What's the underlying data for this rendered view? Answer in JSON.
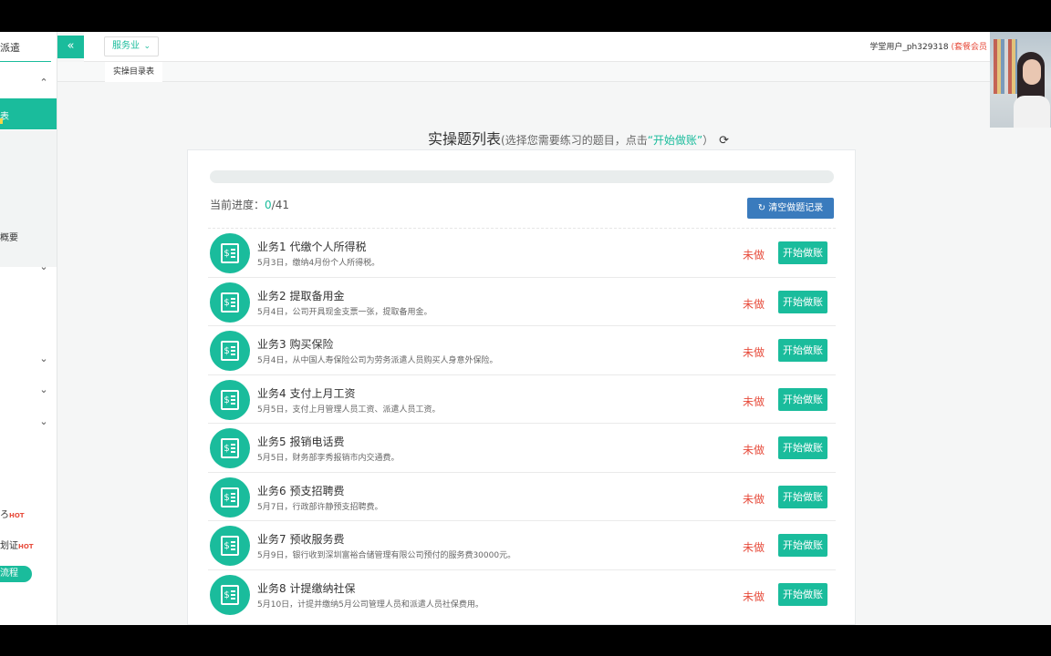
{
  "sidebar": {
    "brand": "派遣",
    "active_item": "表",
    "sub_item": "概要",
    "hot_items": [
      {
        "label": "ろ",
        "badge": "HOT"
      },
      {
        "label": "划证",
        "badge": "HOT"
      }
    ],
    "pill_label": "流程"
  },
  "topbar": {
    "collapse_icon": "«",
    "business_select": "服务业",
    "user_label": "学堂用户_ph329318",
    "user_vip": "(套餐会员"
  },
  "tabs": [
    {
      "label": "实操目录表"
    }
  ],
  "main": {
    "title": "实操题列表",
    "hint_prefix": "(选择您需要练习的题目，点击",
    "hint_action": "“开始做账”",
    "hint_suffix": "）",
    "progress_label": "当前进度：",
    "progress_current": "0",
    "progress_total": "/41",
    "progress_fraction": 0,
    "clear_button": "清空做题记录",
    "tasks": [
      {
        "title": "业务1 代缴个人所得税",
        "desc": "5月3日，缴纳4月份个人所得税。",
        "status": "未做",
        "button": "开始做账"
      },
      {
        "title": "业务2 提取备用金",
        "desc": "5月4日，公司开具现金支票一张，提取备用金。",
        "status": "未做",
        "button": "开始做账"
      },
      {
        "title": "业务3 购买保险",
        "desc": "5月4日，从中国人寿保险公司为劳务派遣人员购买人身意外保险。",
        "status": "未做",
        "button": "开始做账"
      },
      {
        "title": "业务4 支付上月工资",
        "desc": "5月5日，支付上月管理人员工资、派遣人员工资。",
        "status": "未做",
        "button": "开始做账"
      },
      {
        "title": "业务5 报销电话费",
        "desc": "5月5日，财务部李秀报销市内交通费。",
        "status": "未做",
        "button": "开始做账"
      },
      {
        "title": "业务6 预支招聘费",
        "desc": "5月7日，行政部许静预支招聘费。",
        "status": "未做",
        "button": "开始做账"
      },
      {
        "title": "业务7 预收服务费",
        "desc": "5月9日，银行收到深圳富裕合储管理有限公司预付的服务费30000元。",
        "status": "未做",
        "button": "开始做账"
      },
      {
        "title": "业务8 计提缴纳社保",
        "desc": "5月10日，计提并缴纳5月公司管理人员和派遣人员社保费用。",
        "status": "未做",
        "button": "开始做账"
      }
    ]
  },
  "colors": {
    "accent": "#1abc9c",
    "danger": "#e74c3c",
    "primary_button": "#3a7bbd"
  }
}
